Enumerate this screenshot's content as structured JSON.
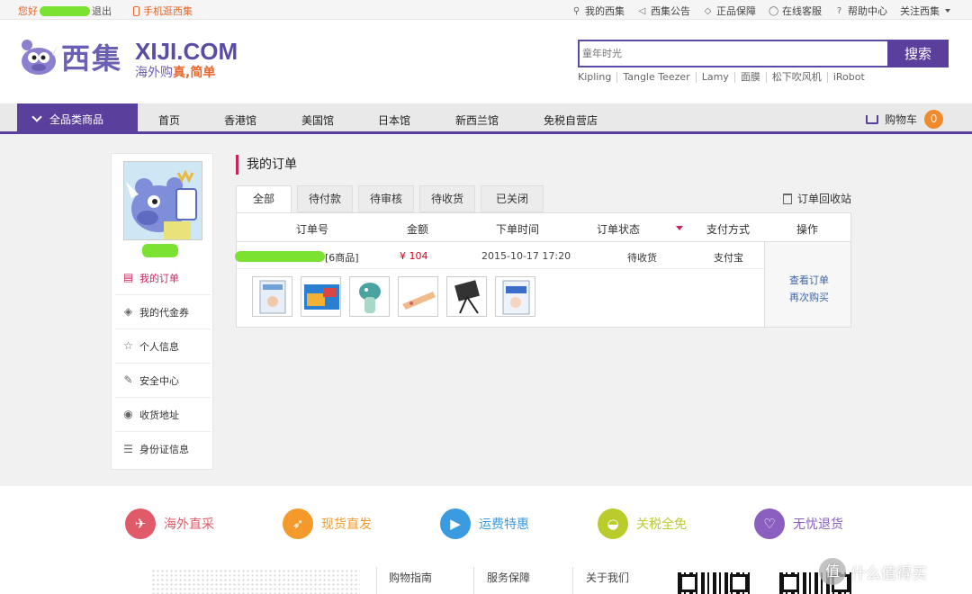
{
  "topbar": {
    "hello": "您好",
    "logout": "退出",
    "mobile": "手机逛西集",
    "links": [
      {
        "icon": "lock-icon",
        "glyph": "⚲",
        "label": "我的西集"
      },
      {
        "icon": "speaker-icon",
        "glyph": "◁",
        "label": "西集公告"
      },
      {
        "icon": "shield-icon",
        "glyph": "◇",
        "label": "正品保障"
      },
      {
        "icon": "chat-icon",
        "glyph": "◯",
        "label": "在线客服"
      },
      {
        "icon": "help-icon",
        "glyph": "?",
        "label": "帮助中心"
      }
    ],
    "follow": "关注西集"
  },
  "header": {
    "logo_cn": "西集",
    "logo_en": "XIJI.COM",
    "slogan_a": "海外购",
    "slogan_b": "真,简单",
    "search_placeholder": "童年时光",
    "search_button": "搜索",
    "hotwords": [
      "Kipling",
      "Tangle Teezer",
      "Lamy",
      "面膜",
      "松下吹风机",
      "iRobot"
    ]
  },
  "nav": {
    "all_categories": "全品类商品",
    "items": [
      "首页",
      "香港馆",
      "美国馆",
      "日本馆",
      "新西兰馆",
      "免税自营店"
    ],
    "cart_label": "购物车",
    "cart_count": "0"
  },
  "sidebar": {
    "items": [
      {
        "label": "我的订单",
        "icon": "order-icon",
        "glyph": "▤"
      },
      {
        "label": "我的代金券",
        "icon": "tag-icon",
        "glyph": "◈"
      },
      {
        "label": "个人信息",
        "icon": "star-icon",
        "glyph": "☆"
      },
      {
        "label": "安全中心",
        "icon": "edit-icon",
        "glyph": "✎"
      },
      {
        "label": "收货地址",
        "icon": "location-icon",
        "glyph": "◉"
      },
      {
        "label": "身份证信息",
        "icon": "id-card-icon",
        "glyph": "☰"
      }
    ]
  },
  "main": {
    "title": "我的订单",
    "tabs": [
      "全部",
      "待付款",
      "待审核",
      "待收货",
      "已关闭"
    ],
    "recycle": "订单回收站",
    "columns": [
      "订单号",
      "金额",
      "下单时间",
      "订单状态",
      "支付方式",
      "操作"
    ],
    "order": {
      "count": "[6商品]",
      "amount": "¥ 104",
      "time": "2015-10-17 17:20",
      "status": "待收货",
      "payment": "支付宝",
      "view": "查看订单",
      "rebuy": "再次购买"
    }
  },
  "features": [
    {
      "label": "海外直采",
      "color": "#e05a6a",
      "glyph": "✈"
    },
    {
      "label": "现货直发",
      "color": "#f39a2a",
      "glyph": "➶"
    },
    {
      "label": "运费特惠",
      "color": "#3a9be0",
      "glyph": "▶"
    },
    {
      "label": "关税全免",
      "color": "#b9cc2c",
      "glyph": "◒"
    },
    {
      "label": "无忧退货",
      "color": "#8a5fc0",
      "glyph": "♡"
    }
  ],
  "footer": {
    "links": [
      "购物指南",
      "服务保障",
      "关于我们"
    ],
    "watermark_badge": "值",
    "watermark": "什么值得买"
  }
}
